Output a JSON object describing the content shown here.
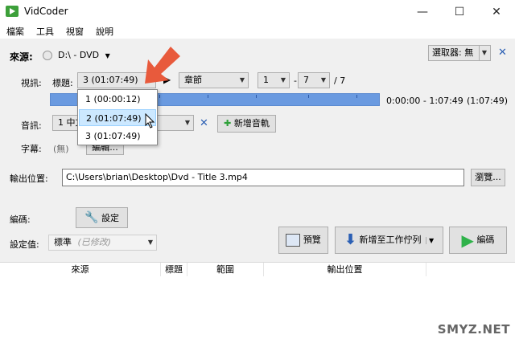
{
  "window": {
    "title": "VidCoder",
    "minimize": "—",
    "maximize": "☐",
    "close": "✕"
  },
  "menu": [
    "檔案",
    "工具",
    "視窗",
    "說明"
  ],
  "source": {
    "label": "來源:",
    "value": "D:\\ - DVD",
    "selector_label": "選取器: 無"
  },
  "video": {
    "label": "視訊:",
    "title_label": "標題:",
    "title_value": "3 (01:07:49)",
    "chapter_value": "章節",
    "range_start": "1",
    "range_sep": "-",
    "range_end": "7",
    "range_total": "/ 7",
    "time_range": "0:00:00 - 1:07:49",
    "duration": "(1:07:49)"
  },
  "title_dropdown": {
    "items": [
      "1 (00:00:12)",
      "2 (01:07:49)",
      "3 (01:07:49)"
    ],
    "highlighted_index": 1
  },
  "audio": {
    "label": "音訊:",
    "value": "1 中文",
    "add_button": "新增音軌"
  },
  "subtitle": {
    "label": "字幕:",
    "value": "(無)",
    "edit_button": "編輯..."
  },
  "output": {
    "label": "輸出位置:",
    "path": "C:\\Users\\brian\\Desktop\\Dvd - Title 3.mp4",
    "browse_button": "瀏覽..."
  },
  "encoding": {
    "label": "編碼:",
    "settings_button": "設定",
    "preset_label": "設定值:",
    "preset_value": "標準",
    "preset_modified": "(已修改)",
    "preview_button": "預覽",
    "add_queue_button": "新增至工作佇列",
    "encode_button": "編碼"
  },
  "queue_columns": [
    "來源",
    "標題",
    "範圍",
    "輸出位置"
  ],
  "watermark": "SMYZ.NET",
  "colors": {
    "progress": "#6a9ae0",
    "accent_arrow": "#e85a3c",
    "encode_green": "#2fb24a",
    "highlight": "#cce8ff"
  }
}
